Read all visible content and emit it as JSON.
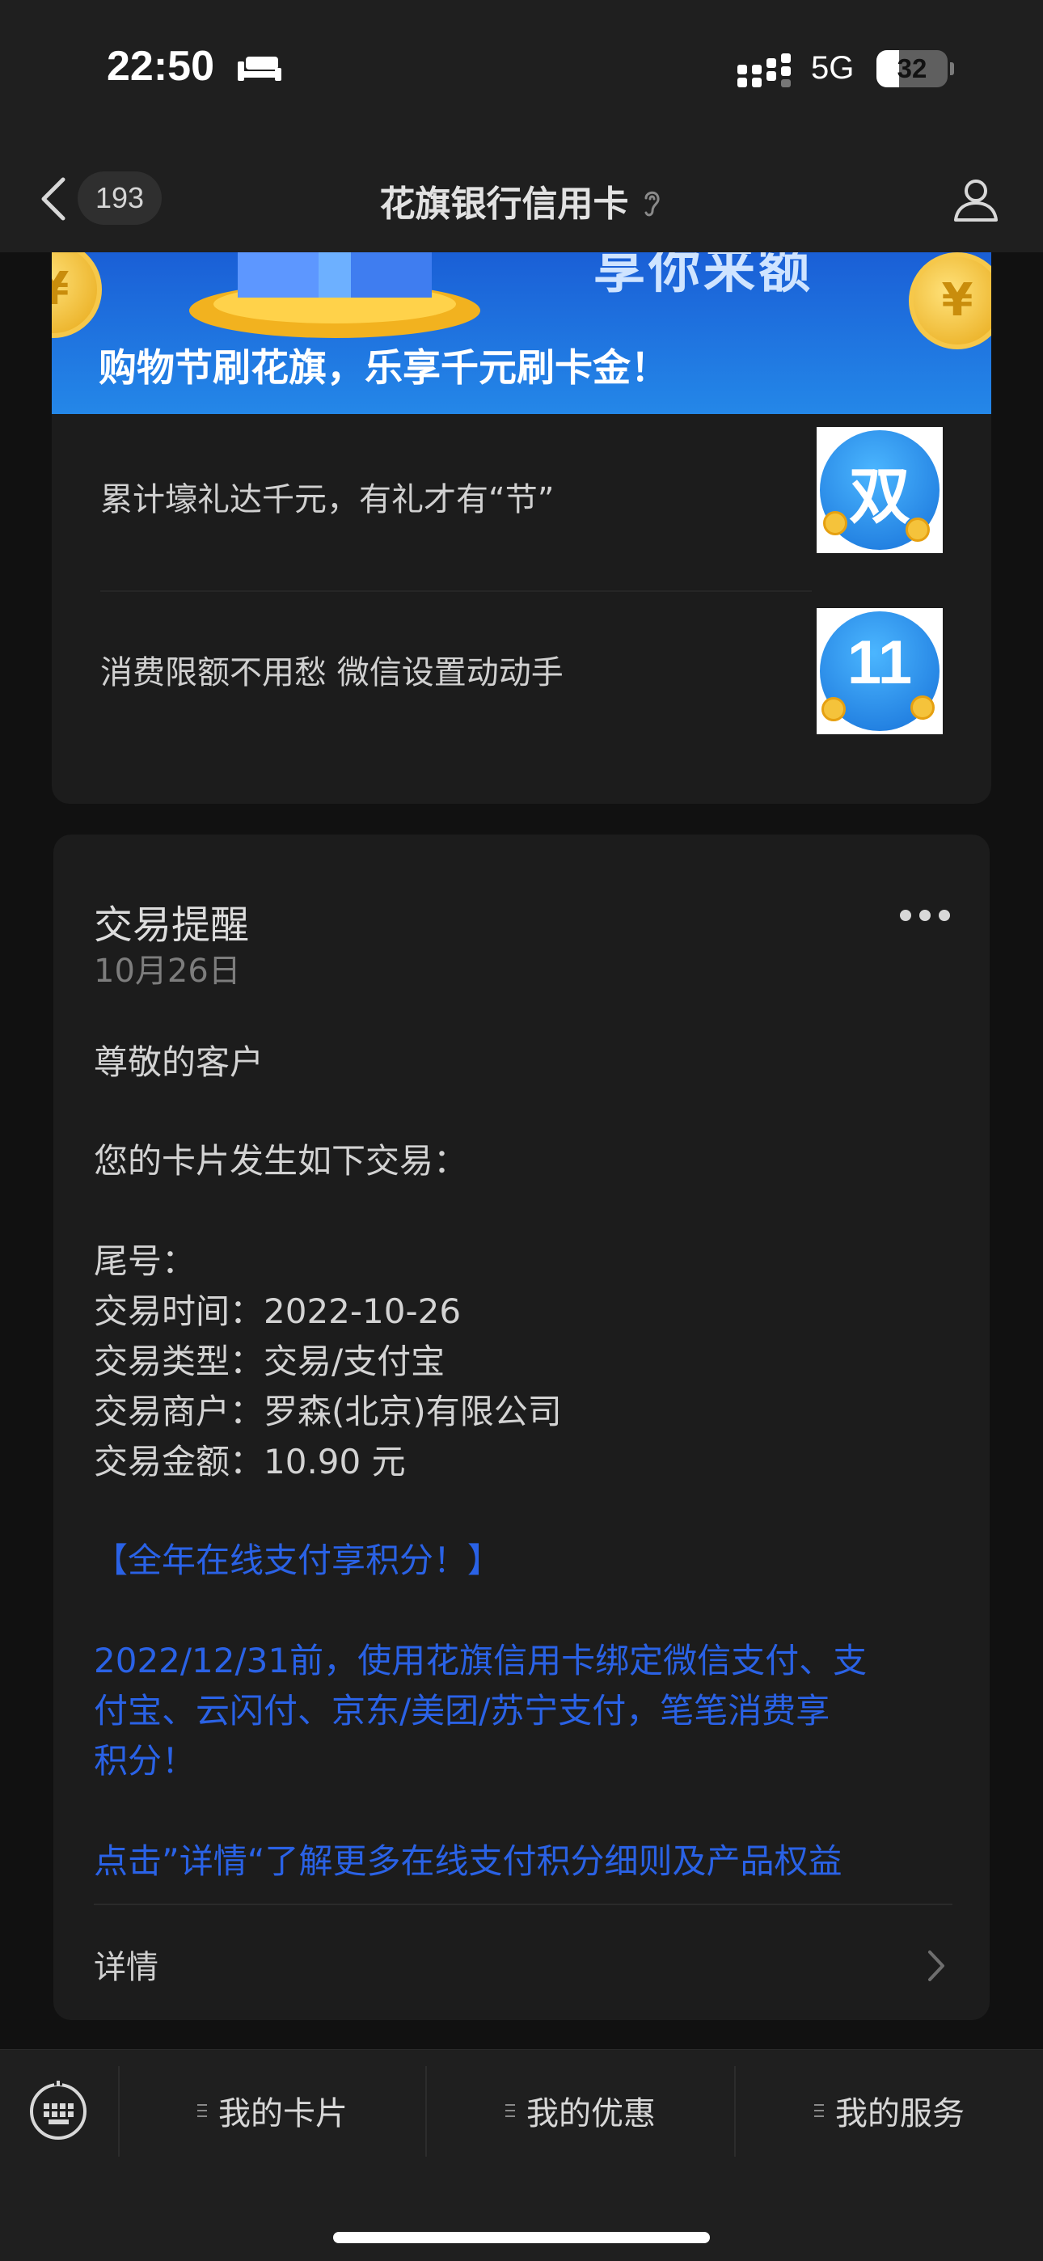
{
  "status_bar": {
    "time": "22:50",
    "network": "5G",
    "battery": "32",
    "battery_level": 0.32
  },
  "navbar": {
    "unread_count": "193",
    "title": "花旗银行信用卡"
  },
  "top_card": {
    "banner_top_text": "享你来额",
    "banner_text": "购物节刷花旗，乐享千元刷卡金！",
    "articles": [
      {
        "title": "累计壕礼达千元，有礼才有“节”",
        "thumb_char": "双"
      },
      {
        "title": "消费限额不用愁 微信设置动动手",
        "thumb_char": "11"
      }
    ]
  },
  "message": {
    "title": "交易提醒",
    "date": "10月26日",
    "greeting": "尊敬的客户",
    "intro": "您的卡片发生如下交易：",
    "fields": [
      "尾号：",
      "交易时间：2022-10-26",
      "交易类型：交易/支付宝",
      "交易商户：罗森(北京)有限公司",
      "交易金额：10.90 元"
    ],
    "promo_title": "【全年在线支付享积分！】",
    "promo_lines": [
      "2022/12/31前，使用花旗信用卡绑定微信支付、支",
      "付宝、云闪付、京东/美团/苏宁支付，笔笔消费享",
      "积分！"
    ],
    "promo_link": "点击”详情“了解更多在线支付积分细则及产品权益",
    "detail_label": "详情"
  },
  "bottom_menu": {
    "items": [
      "我的卡片",
      "我的优惠",
      "我的服务"
    ]
  },
  "colors": {
    "background": "#111111",
    "card": "#1c1c1c",
    "bar": "#1f1f1f",
    "link_blue": "#2a62e6",
    "banner_blue": "#1f78e0"
  },
  "icons": [
    "sleep-icon",
    "signal-icon",
    "battery-icon",
    "back-icon",
    "ear-icon",
    "profile-icon",
    "more-icon",
    "chevron-right-icon",
    "keyboard-icon",
    "menu-lines-icon"
  ]
}
